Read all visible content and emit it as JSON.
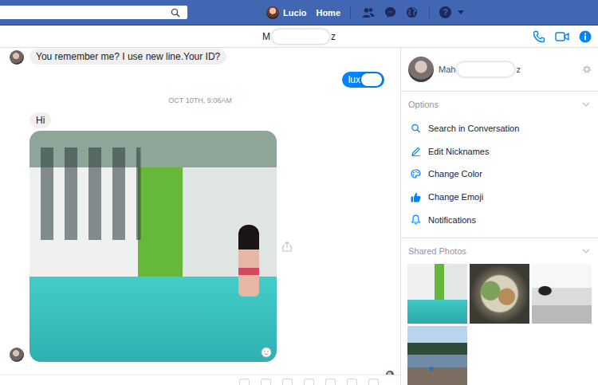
{
  "topbar": {
    "user": "Lucio",
    "links": [
      "Home"
    ],
    "help": "?"
  },
  "conversation": {
    "title_start": "M",
    "title_end": "z"
  },
  "messages": [
    {
      "kind": "text",
      "from": "them",
      "text": "You remember me? I use new line.Your ID?",
      "redacted": false
    },
    {
      "kind": "text",
      "from": "me",
      "text": "lux",
      "redacted": true
    },
    {
      "kind": "time",
      "text": "OCT 10TH, 9:06AM"
    },
    {
      "kind": "text",
      "from": "them",
      "text": "Hi",
      "redacted": false
    },
    {
      "kind": "photo",
      "from": "them"
    }
  ],
  "profile": {
    "name_start": "Mah",
    "name_end": "z"
  },
  "options": {
    "title": "Options",
    "expanded": true,
    "items": [
      {
        "label": "Search in Conversation"
      },
      {
        "label": "Edit Nicknames"
      },
      {
        "label": "Change Color"
      },
      {
        "label": "Change Emoji"
      },
      {
        "label": "Notifications"
      }
    ]
  },
  "shared_photos": {
    "title": "Shared Photos",
    "expanded": true
  }
}
